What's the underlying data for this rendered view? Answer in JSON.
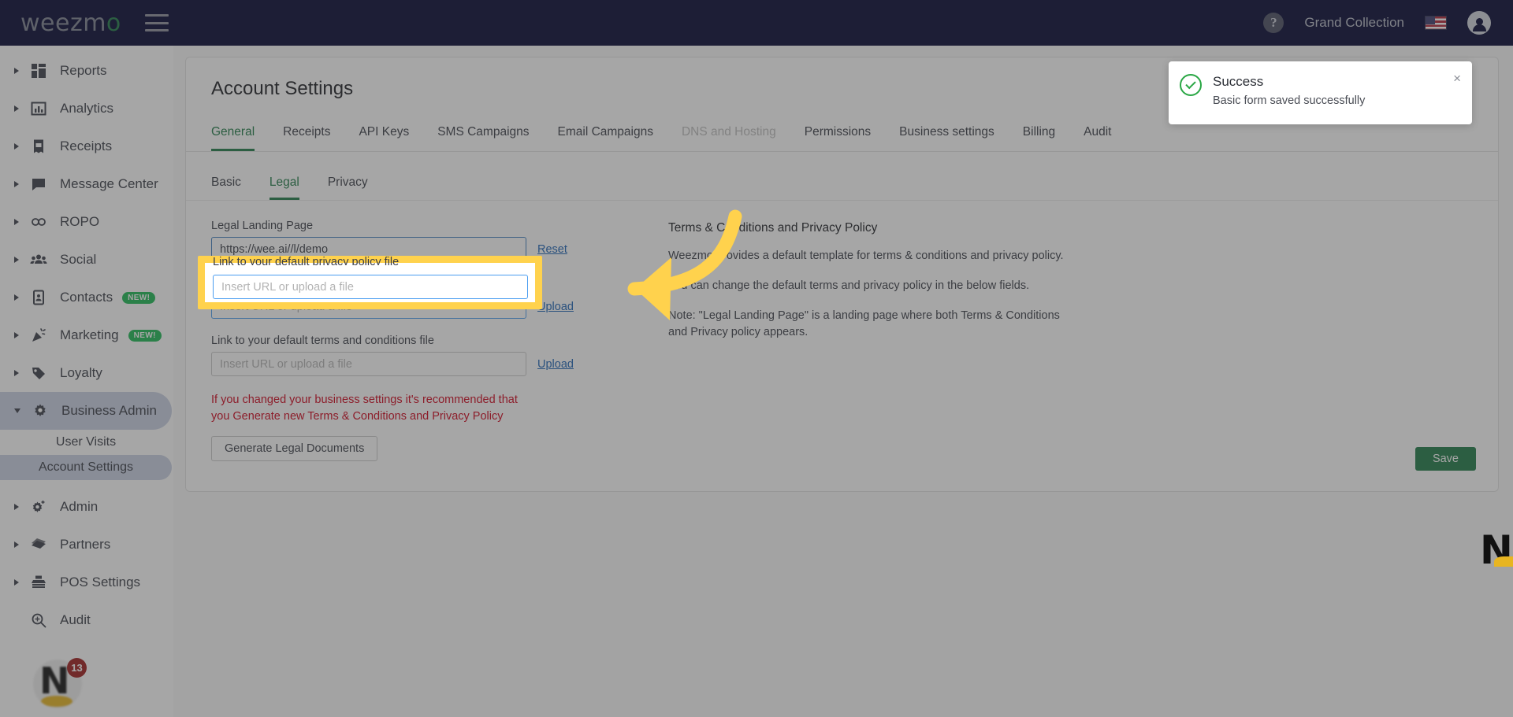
{
  "topbar": {
    "brand": "weezm",
    "brand_accent": "o",
    "menu_icon": "hamburger-icon",
    "help_label": "?",
    "account_name": "Grand Collection",
    "locale_flag": "us-flag",
    "user_icon": "user-avatar-icon"
  },
  "sidebar": {
    "items": [
      {
        "label": "Reports",
        "icon": "dashboard-icon",
        "badge": null,
        "expanded": false,
        "active": false
      },
      {
        "label": "Analytics",
        "icon": "bar-chart-icon",
        "badge": null,
        "expanded": false,
        "active": false
      },
      {
        "label": "Receipts",
        "icon": "receipt-icon",
        "badge": null,
        "expanded": false,
        "active": false
      },
      {
        "label": "Message Center",
        "icon": "chat-bubble-icon",
        "badge": null,
        "expanded": false,
        "active": false
      },
      {
        "label": "ROPO",
        "icon": "infinity-icon",
        "badge": null,
        "expanded": false,
        "active": false
      },
      {
        "label": "Social",
        "icon": "people-group-icon",
        "badge": null,
        "expanded": false,
        "active": false
      },
      {
        "label": "Contacts",
        "icon": "contact-card-icon",
        "badge": "NEW!",
        "expanded": false,
        "active": false
      },
      {
        "label": "Marketing",
        "icon": "megaphone-icon",
        "badge": "NEW!",
        "expanded": false,
        "active": false
      },
      {
        "label": "Loyalty",
        "icon": "tag-icon",
        "badge": null,
        "expanded": false,
        "active": false
      },
      {
        "label": "Business Admin",
        "icon": "gear-icon",
        "badge": null,
        "expanded": true,
        "active": true
      }
    ],
    "sub_items": [
      {
        "label": "User Visits",
        "active": false
      },
      {
        "label": "Account Settings",
        "active": true
      }
    ],
    "items_after": [
      {
        "label": "Admin",
        "icon": "gear-plus-icon",
        "badge": null,
        "expanded": false,
        "active": false
      },
      {
        "label": "Partners",
        "icon": "handshake-icon",
        "badge": null,
        "expanded": false,
        "active": false
      },
      {
        "label": "POS Settings",
        "icon": "cash-register-icon",
        "badge": null,
        "expanded": false,
        "active": false
      },
      {
        "label": "Audit",
        "icon": "search-plus-icon",
        "badge": null,
        "expanded": false,
        "active": false
      }
    ],
    "avatar": {
      "initial": "N",
      "notification_count": "13"
    }
  },
  "page": {
    "title": "Account Settings",
    "tabs": [
      {
        "label": "General",
        "active": true,
        "disabled": false
      },
      {
        "label": "Receipts",
        "active": false,
        "disabled": false
      },
      {
        "label": "API Keys",
        "active": false,
        "disabled": false
      },
      {
        "label": "SMS Campaigns",
        "active": false,
        "disabled": false
      },
      {
        "label": "Email Campaigns",
        "active": false,
        "disabled": false
      },
      {
        "label": "DNS and Hosting",
        "active": false,
        "disabled": true
      },
      {
        "label": "Permissions",
        "active": false,
        "disabled": false
      },
      {
        "label": "Business settings",
        "active": false,
        "disabled": false
      },
      {
        "label": "Billing",
        "active": false,
        "disabled": false
      },
      {
        "label": "Audit",
        "active": false,
        "disabled": false
      }
    ],
    "subtabs": [
      {
        "label": "Basic",
        "active": false
      },
      {
        "label": "Legal",
        "active": true
      },
      {
        "label": "Privacy",
        "active": false
      }
    ]
  },
  "form": {
    "legal_landing_page": {
      "label": "Legal Landing Page",
      "value": "https://wee.ai//l/demo",
      "placeholder": "",
      "action_label": "Reset"
    },
    "privacy_policy_file": {
      "label": "Link to your default privacy policy file",
      "value": "",
      "placeholder": "Insert URL or upload a file",
      "action_label": "Upload"
    },
    "terms_file": {
      "label": "Link to your default terms and conditions file",
      "value": "",
      "placeholder": "Insert URL or upload a file",
      "action_label": "Upload"
    },
    "warning_line1": "If you changed your business settings it's recommended that",
    "warning_line2": "you Generate new Terms & Conditions and Privacy Policy",
    "generate_button": "Generate Legal Documents",
    "save_button": "Save"
  },
  "info_panel": {
    "title": "Terms & Conditions and Privacy Policy",
    "p1": "Weezmo provides a default template for terms & conditions and privacy policy.",
    "p2": "You can change the default terms and privacy policy in the below fields.",
    "p3": "Note: \"Legal Landing Page\" is a landing page where both Terms & Conditions and Privacy policy appears."
  },
  "toast": {
    "title": "Success",
    "message": "Basic form saved successfully",
    "close_label": "×",
    "icon": "check-circle-icon",
    "accent_color": "#2aa745"
  },
  "annotation": {
    "highlight_color": "#FFD24D",
    "arrow_icon": "curved-arrow-left-icon"
  },
  "colors": {
    "brand_dark": "#020531",
    "accent_green": "#1e7a46",
    "link_blue": "#1b62b5",
    "warning_red": "#d0021b"
  }
}
